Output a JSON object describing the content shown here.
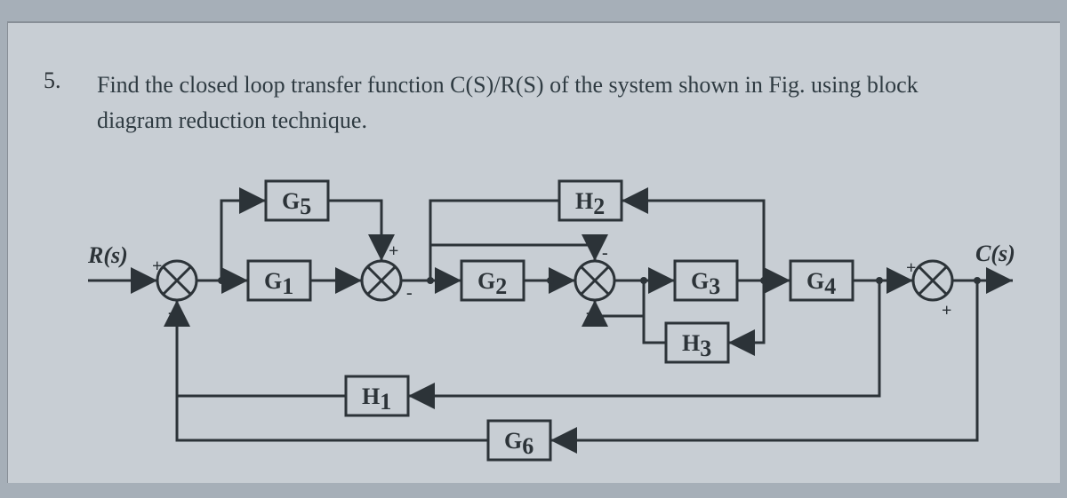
{
  "question": {
    "number": "5.",
    "text": "Find the closed loop transfer function C(S)/R(S) of the system shown in Fig. using block diagram reduction technique."
  },
  "diagram": {
    "input_label": "R(s)",
    "output_label": "C(s)",
    "blocks": {
      "G1": "G",
      "G1sub": "1",
      "G2": "G",
      "G2sub": "2",
      "G3": "G",
      "G3sub": "3",
      "G4": "G",
      "G4sub": "4",
      "G5": "G",
      "G5sub": "5",
      "G6": "G",
      "G6sub": "6",
      "H1": "H",
      "H1sub": "1",
      "H2": "H",
      "H2sub": "2",
      "H3": "H",
      "H3sub": "3"
    },
    "signs": {
      "s1_top": "+",
      "s1_bot": "-",
      "s2_top": "+",
      "s2_bot": "-",
      "s3_top": "-",
      "s3_bot": "-",
      "s4_top": "+",
      "s4_bot": "+"
    }
  }
}
